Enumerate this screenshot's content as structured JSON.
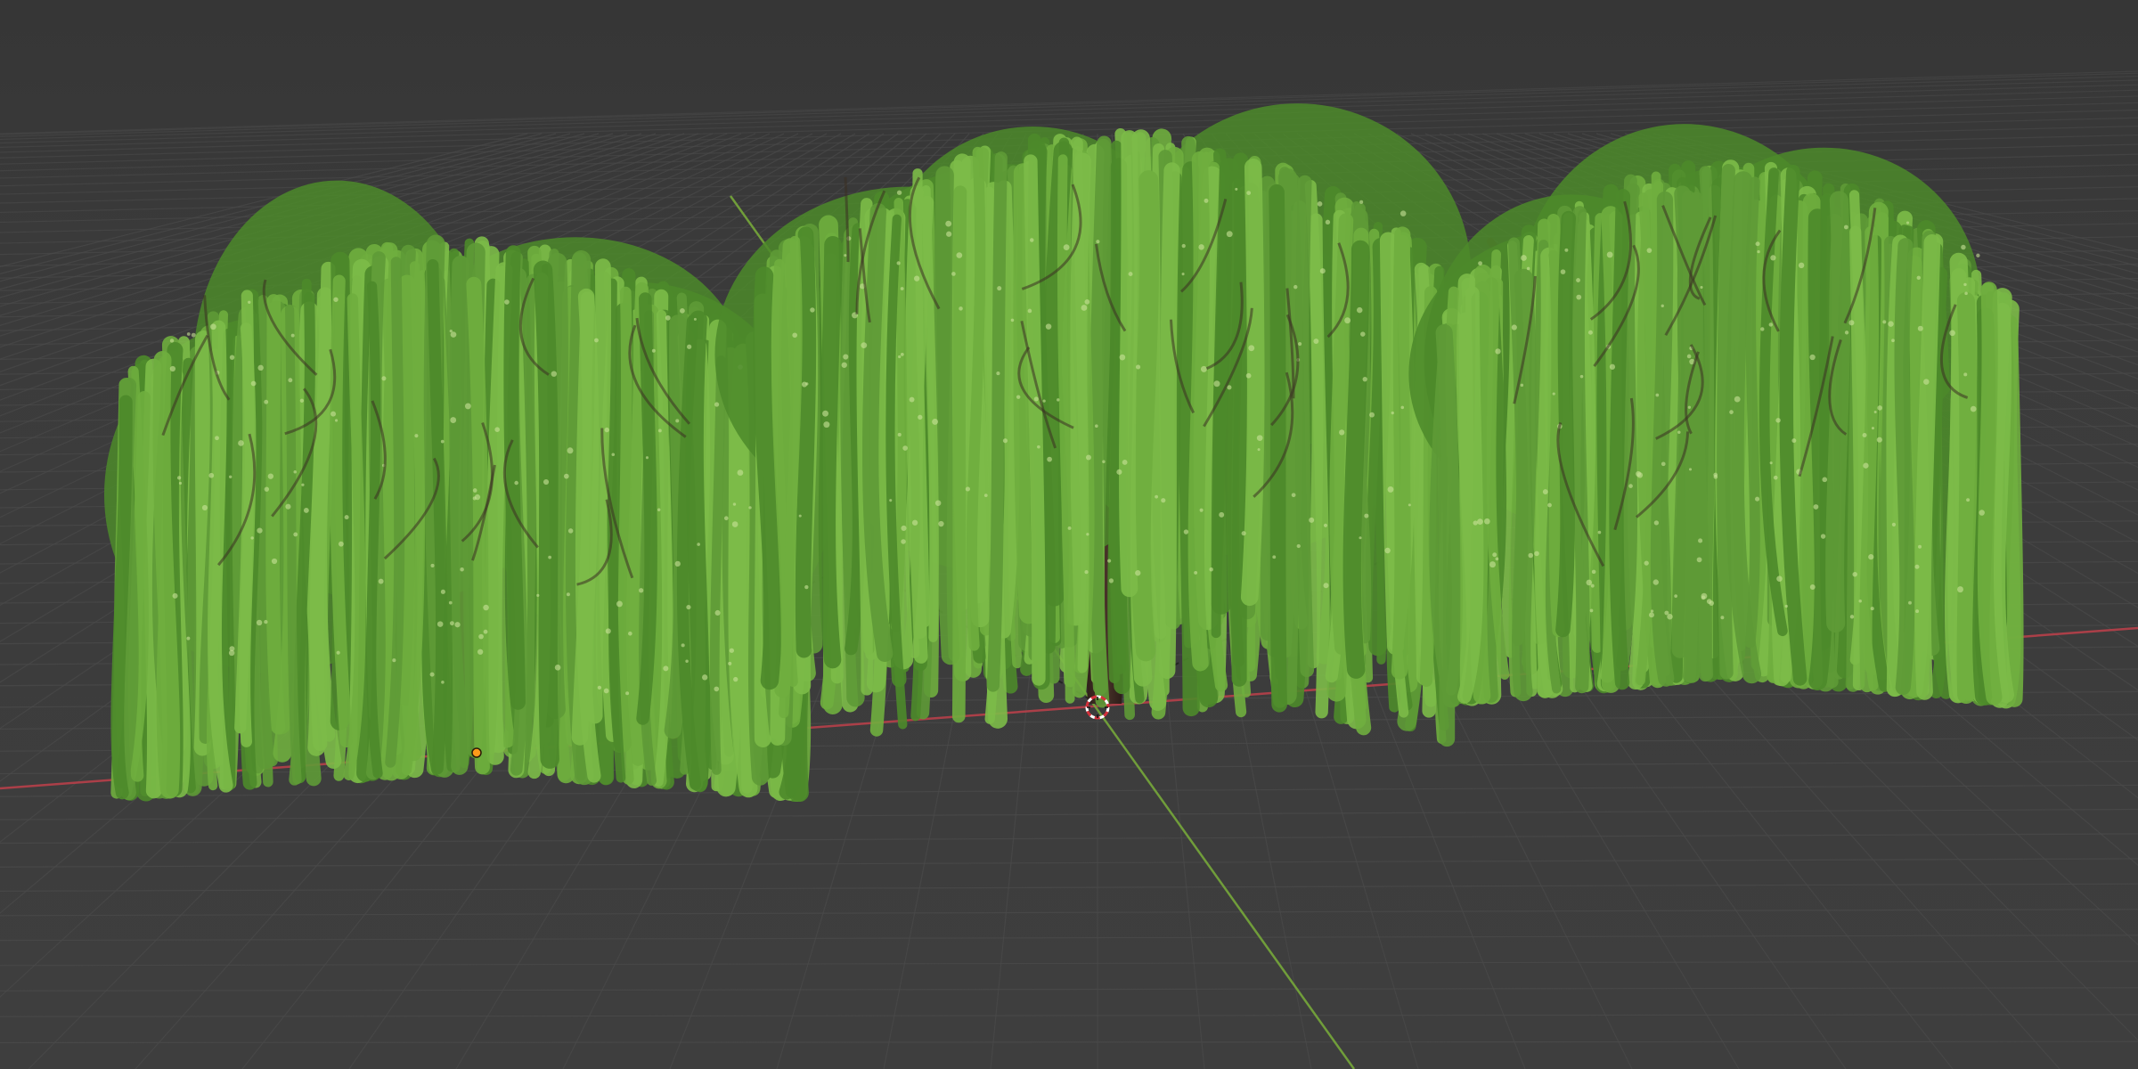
{
  "viewport": {
    "mode": "3d-viewport",
    "shading": "material-preview",
    "grid": true,
    "background_color": "#3a3a3a",
    "grid_color": "#4a4a4a",
    "x_axis_color": "#b8404a",
    "y_axis_color": "#76a83a"
  },
  "scene": {
    "objects": [
      {
        "name": "willow-tree-left",
        "type": "weeping-willow",
        "selected": true
      },
      {
        "name": "willow-tree-center",
        "type": "weeping-willow",
        "selected": false
      },
      {
        "name": "willow-tree-right",
        "type": "weeping-willow",
        "selected": false
      }
    ],
    "foliage_colors": [
      "#5e9a36",
      "#6fae3e",
      "#4c8a2a",
      "#7cbb48"
    ],
    "bark_color": "#3e2a22",
    "relationship_lines": true
  },
  "icons": {
    "cursor": "3d-cursor-icon",
    "origin": "object-origin-icon"
  }
}
